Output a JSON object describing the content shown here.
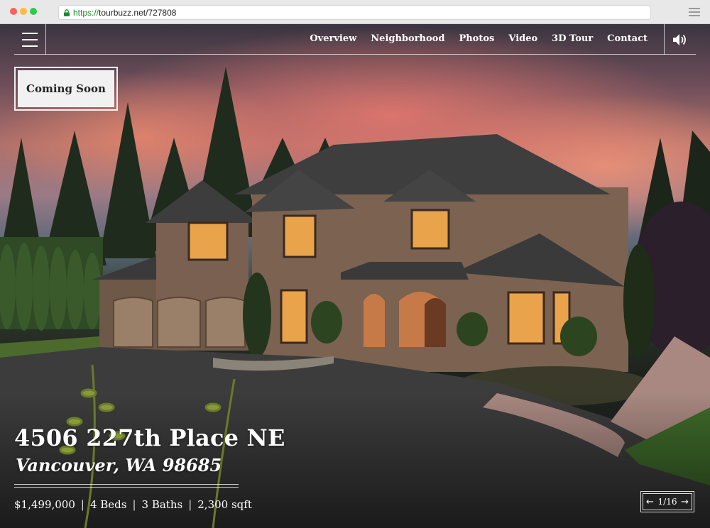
{
  "browser": {
    "url_scheme": "https://",
    "url_rest": "tourbuzz.net/727808"
  },
  "nav": {
    "links": [
      "Overview",
      "Neighborhood",
      "Photos",
      "Video",
      "3D Tour",
      "Contact"
    ]
  },
  "badge": {
    "label": "Coming Soon"
  },
  "listing": {
    "street": "4506 227th Place NE",
    "city_line": "Vancouver, WA 98685",
    "price": "$1,499,000",
    "beds": "4 Beds",
    "baths": "3 Baths",
    "sqft": "2,300 sqft",
    "separator": "|"
  },
  "pager": {
    "label": "1/16",
    "prev_icon": "arrow-left-icon",
    "next_icon": "arrow-right-icon"
  },
  "icons": {
    "menu": "hamburger-icon",
    "sound": "speaker-icon",
    "lock": "lock-icon"
  }
}
